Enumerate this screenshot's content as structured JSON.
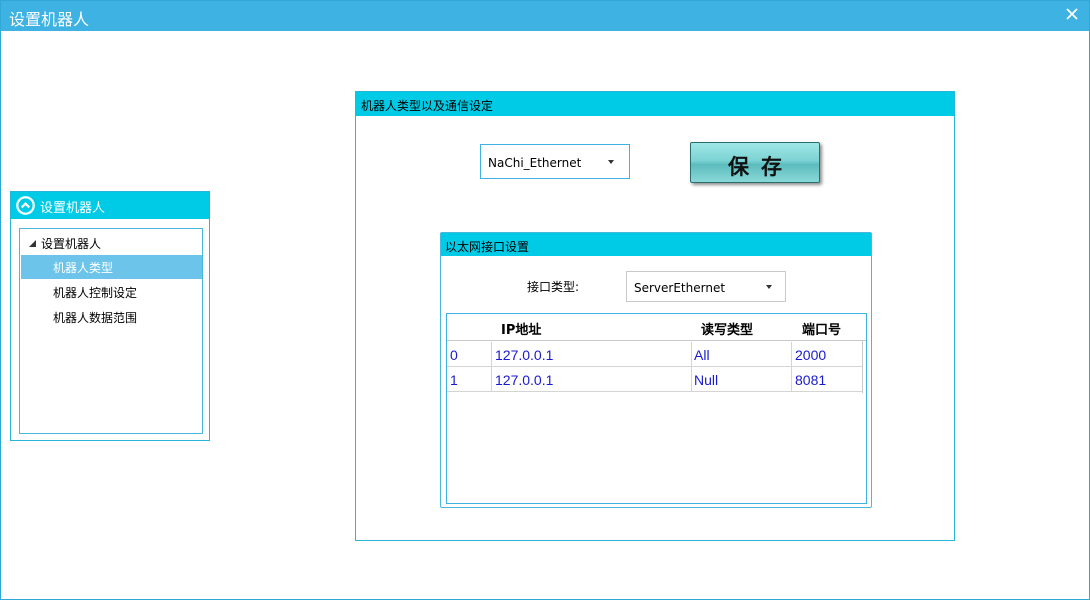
{
  "window": {
    "title": "设置机器人"
  },
  "sidebar": {
    "header": "设置机器人",
    "tree": {
      "root": "设置机器人",
      "items": [
        {
          "label": "机器人类型"
        },
        {
          "label": "机器人控制设定"
        },
        {
          "label": "机器人数据范围"
        }
      ]
    }
  },
  "main": {
    "group_title": "机器人类型以及通信设定",
    "robot_type": "NaChi_Ethernet",
    "save_label": "保存",
    "ethernet": {
      "title": "以太网接口设置",
      "interface_label": "接口类型:",
      "interface_value": "ServerEthernet",
      "columns": [
        "IP地址",
        "读写类型",
        "端口号"
      ],
      "rows": [
        {
          "index": "0",
          "ip": "127.0.0.1",
          "rw": "All",
          "port": "2000"
        },
        {
          "index": "1",
          "ip": "127.0.0.1",
          "rw": "Null",
          "port": "8081"
        }
      ]
    }
  },
  "colors": {
    "titlebar": "#3db2e3",
    "header": "#00cbe6",
    "selected": "#6cc4ea",
    "cell_text": "#1a1ad0"
  },
  "icons": [
    "close-icon",
    "collapse-circle-icon",
    "expand-triangle-icon",
    "dropdown-arrow-icon"
  ]
}
